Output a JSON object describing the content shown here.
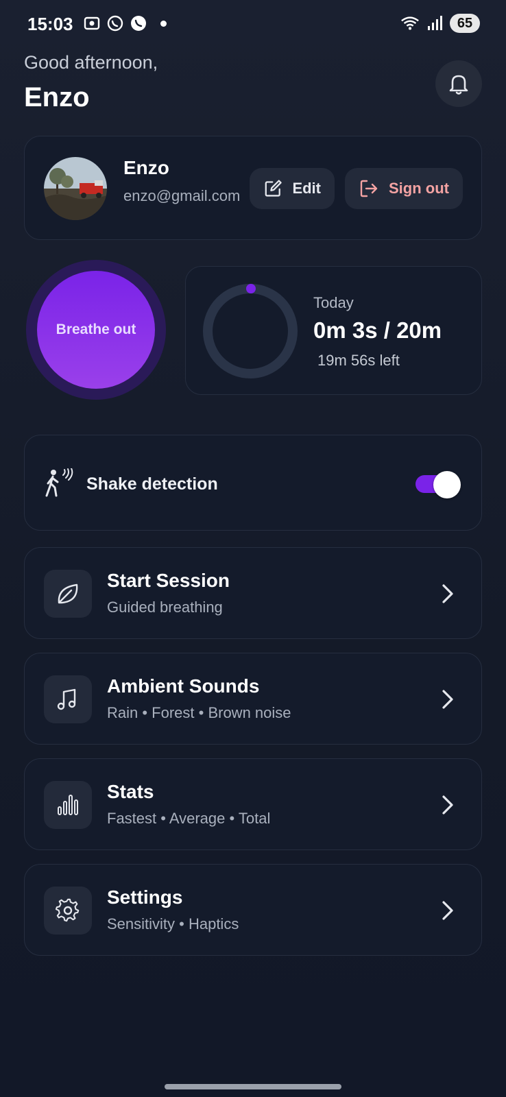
{
  "status_bar": {
    "time": "15:03",
    "battery": "65"
  },
  "header": {
    "greeting": "Good afternoon,",
    "username": "Enzo"
  },
  "profile": {
    "name": "Enzo",
    "email": "enzo@gmail.com",
    "edit_label": "Edit",
    "signout_label": "Sign out"
  },
  "breathe": {
    "label": "Breathe out"
  },
  "today": {
    "label": "Today",
    "value": "0m 3s / 20m",
    "remaining": "19m 56s left",
    "progress_fraction": 0.0025
  },
  "shake": {
    "label": "Shake detection",
    "enabled": true
  },
  "menu": [
    {
      "title": "Start Session",
      "subtitle": "Guided breathing",
      "icon": "leaf-icon"
    },
    {
      "title": "Ambient Sounds",
      "subtitle": "Rain • Forest • Brown noise",
      "icon": "music-note-icon"
    },
    {
      "title": "Stats",
      "subtitle": "Fastest • Average • Total",
      "icon": "bar-chart-icon"
    },
    {
      "title": "Settings",
      "subtitle": "Sensitivity • Haptics",
      "icon": "gear-icon"
    }
  ],
  "colors": {
    "background": "#161c2a",
    "card": "#141b2b",
    "accent": "#7a23e8",
    "signout": "#f4a3a3"
  }
}
